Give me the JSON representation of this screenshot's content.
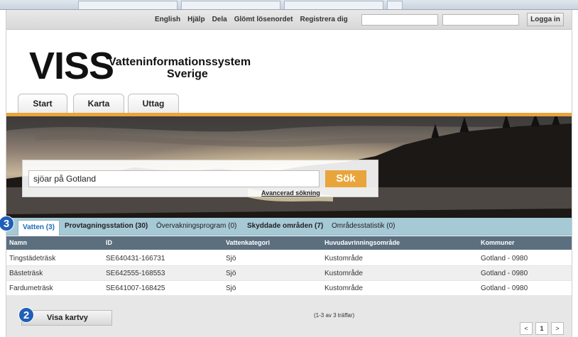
{
  "toplinks": {
    "english": "English",
    "help": "Hjälp",
    "share": "Dela",
    "forgot": "Glömt lösenordet",
    "register": "Registrera dig"
  },
  "login": {
    "button": "Logga in",
    "username_value": "",
    "password_value": ""
  },
  "logo": {
    "main": "VISS",
    "sub1": "Vatteninformationssystem",
    "sub2": "Sverige"
  },
  "nav": {
    "tabs": [
      "Start",
      "Karta",
      "Uttag"
    ]
  },
  "search": {
    "value": "sjöar på Gotland",
    "button": "Sök",
    "advanced": "Avancerad sökning"
  },
  "result_tabs": {
    "vatten": "Vatten (3)",
    "provtagning": "Provtagningsstation (30)",
    "overvakning": "Övervakningsprogram (0)",
    "skyddade": "Skyddade områden (7)",
    "statistik": "Områdesstatistik (0)"
  },
  "table": {
    "headers": [
      "Namn",
      "ID",
      "Vattenkategori",
      "Huvudavrinningsområde",
      "Kommuner"
    ],
    "rows": [
      [
        "Tingstädeträsk",
        "SE640431-166731",
        "Sjö",
        "Kustområde",
        "Gotland - 0980"
      ],
      [
        "Bästeträsk",
        "SE642555-168553",
        "Sjö",
        "Kustområde",
        "Gotland - 0980"
      ],
      [
        "Fardumeträsk",
        "SE641007-168425",
        "Sjö",
        "Kustområde",
        "Gotland - 0980"
      ]
    ]
  },
  "bottom": {
    "kartvy": "Visa kartvy",
    "hits": "(1-3 av 3 träffar)",
    "pager": {
      "prev": "<",
      "page": "1",
      "next": ">"
    }
  },
  "badges": {
    "tabs_badge": "3",
    "kartvy_badge": "2"
  },
  "colors": {
    "accent_orange": "#e9a43c",
    "tab_blue": "#a6c9d6",
    "badge_blue": "#1f5fb8",
    "table_header": "#5b6f7f"
  }
}
